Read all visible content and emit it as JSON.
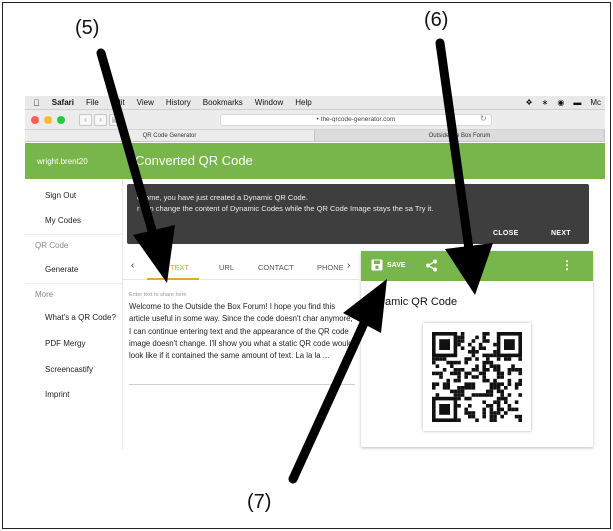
{
  "callouts": {
    "c5": "(5)",
    "c6": "(6)",
    "c7": "(7)"
  },
  "menubar": {
    "app": "Safari",
    "items": [
      "File",
      "Edit",
      "View",
      "History",
      "Bookmarks",
      "Window",
      "Help"
    ],
    "right_text": "Mc"
  },
  "browser": {
    "url": "the-qrcode-generator.com",
    "tabs": [
      "QR Code Generator",
      "Outside the Box Forum"
    ]
  },
  "header": {
    "username": "wright.brent20",
    "title": "Converted QR Code"
  },
  "sidebar": {
    "items": [
      {
        "label": "Sign Out"
      },
      {
        "label": "My Codes"
      },
      {
        "label": "Generate"
      },
      {
        "label": "What's a QR Code?"
      },
      {
        "label": "PDF Mergy"
      },
      {
        "label": "Screencastify"
      },
      {
        "label": "Imprint"
      }
    ],
    "sections": [
      "QR Code",
      "More"
    ]
  },
  "notice": {
    "line1": "esome, you have just created a Dynamic QR Code.",
    "line2": "r can change the content of Dynamic Codes while the QR Code Image stays the sa     Try it.",
    "close": "CLOSE",
    "next": "NEXT"
  },
  "content_tabs": [
    {
      "label": "E TEXT",
      "active": true
    },
    {
      "label": "URL",
      "active": false
    },
    {
      "label": "CONTACT",
      "active": false
    },
    {
      "label": "PHONE",
      "active": false
    }
  ],
  "editor": {
    "hint": "Enter text to share here",
    "text": "Welcome to the Outside the Box Forum! I hope you find this article useful in some way. Since the code doesn't char anymore, I can continue entering text and the appearance of the QR code image doesn't change. I'll show you what a static QR code would look like if it contained the same amount of text. La la la ..."
  },
  "qr_panel": {
    "save_label": "SAVE",
    "title": "amic QR Code"
  },
  "colors": {
    "brand_green": "#78b64b",
    "tab_accent": "#e0aa27",
    "notice_bg": "#3e3e3e"
  },
  "icons": [
    "apple-icon",
    "save-icon",
    "share-icon",
    "more-vert-icon",
    "chevron-left-icon",
    "chevron-right-icon",
    "qr-code-icon",
    "reload-icon"
  ]
}
